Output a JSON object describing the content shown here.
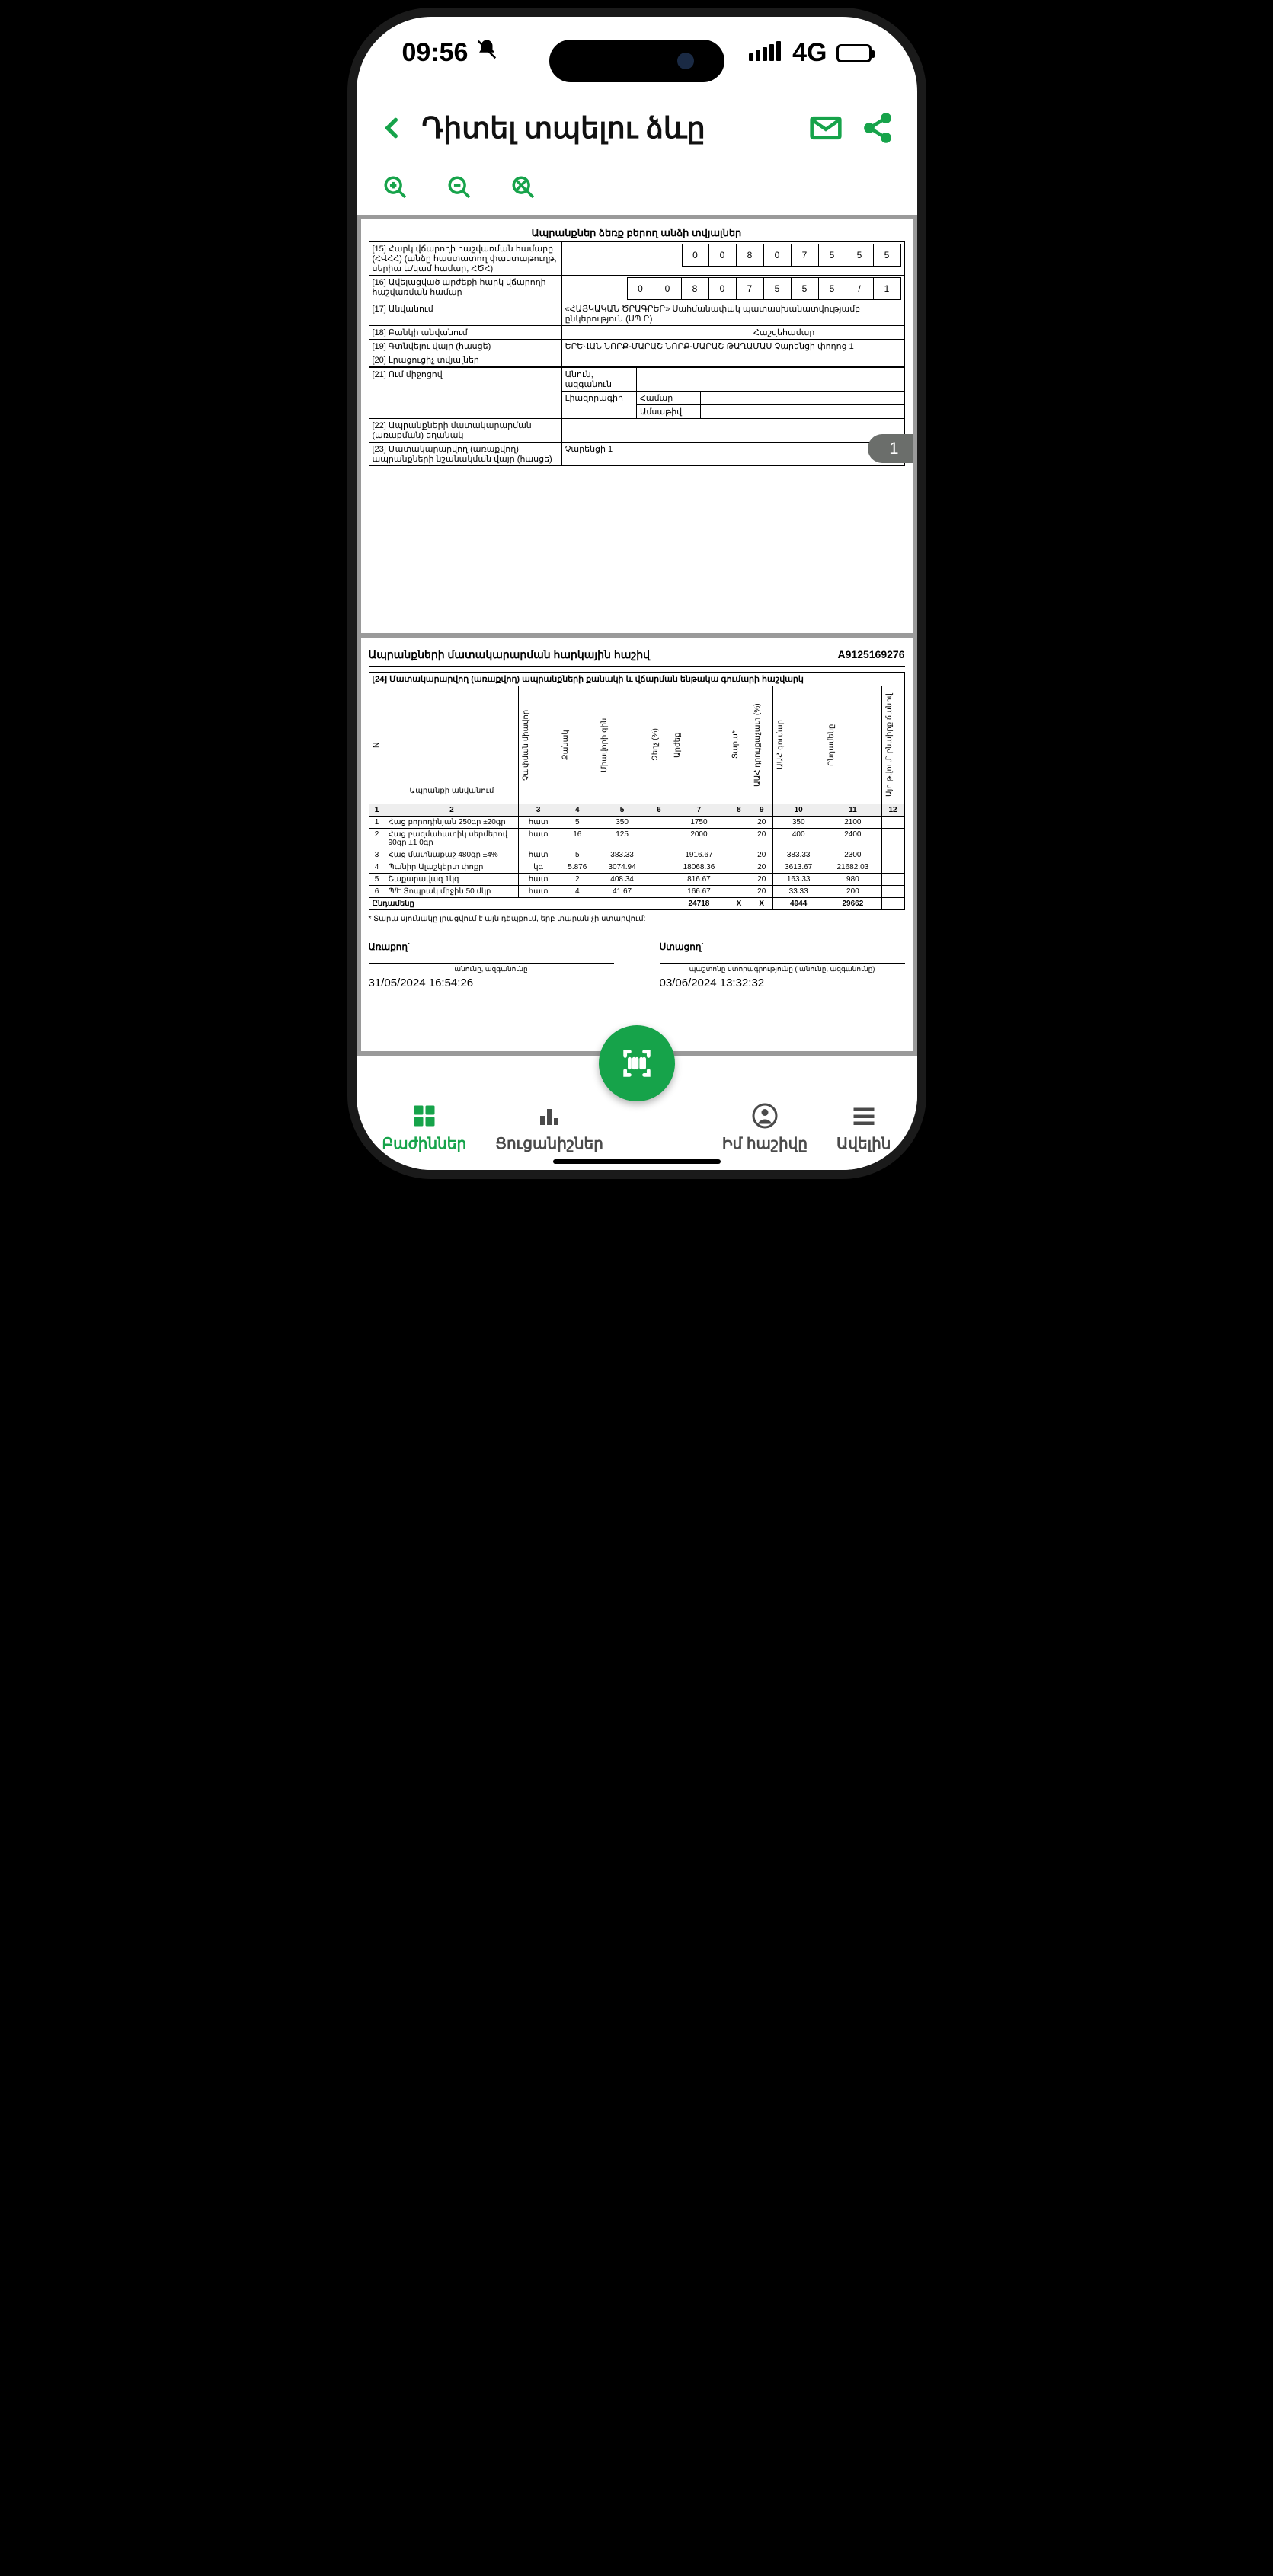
{
  "status": {
    "time": "09:56",
    "network": "4G"
  },
  "header": {
    "title": "Դիտել տպելու ձևը"
  },
  "page_tab": "1",
  "section1": {
    "title": "Ապրանքներ ձեռք բերող անձի տվյալներ",
    "row15_label": "[15] Հարկ վճարողի հաշվառման համարը (ՀՎՀՀ) (անձը հաստատող փաստաթուղթ, սերիա և/կամ համար, ՀԾՀ)",
    "row15_digits": [
      "0",
      "0",
      "8",
      "0",
      "7",
      "5",
      "5",
      "5"
    ],
    "row16_label": "[16] Ավելացված արժեքի հարկ վճարողի հաշվառման համար",
    "row16_digits": [
      "0",
      "0",
      "8",
      "0",
      "7",
      "5",
      "5",
      "5",
      "/",
      "1"
    ],
    "row17_label": "[17] Անվանում",
    "row17_value": "«ՀԱՅԿԱԿԱՆ ԾՐԱԳՐԵՐ» Սահմանափակ պատասխանատվությամբ ընկերություն (ՍՊ Ը)",
    "row18_label": "[18] Բանկի անվանում",
    "row18_col2_label": "Հաշվեհամար",
    "row19_label": "[19] Գտնվելու վայր (հասցե)",
    "row19_value": "ԵՐԵՎԱՆ ՆՈՐՔ-ՄԱՐԱՇ ՆՈՐՔ-ՄԱՐԱՇ ԹԱՂԱՄԱՍ Չարենցի փողոց 1",
    "row20_label": "[20] Լրացուցիչ տվյալներ",
    "row21_label": "[21] Ում միջոցով",
    "row21_a": "Անուն, ազգանուն",
    "row21_b": "Լիազորագիր",
    "row21_b1": "Համար",
    "row21_b2": "Ամսաթիվ",
    "row22_label": "[22] Ապրանքների մատակարարման (առաքման) եղանակ",
    "row23_label": "[23] Մատակարարվող (առաքվող) ապրանքների նշանակման վայր (հասցե)",
    "row23_value": "Չարենցի 1"
  },
  "section2": {
    "title_left": "Ապրանքների մատակարարման հարկային հաշիվ",
    "title_right": "A9125169276",
    "row24_header": "[24] Մատակարարվող (առաքվող) ապրանքների քանակի և վճարման ենթակա գումարի հաշվարկ",
    "cols": {
      "c1": "N",
      "c2": "Ապրանքի անվանում",
      "c3": "Չափման միավոր",
      "c4": "Քանակ",
      "c5": "Միավորի գին",
      "c6": "Զեղչ (%)",
      "c7": "Արժեք",
      "c8": "Տարա*",
      "c9": "ԱԱՀ դրույքաչափ (%)",
      "c10": "ԱԱՀ գումար",
      "c11": "Ընդամենը",
      "c12": "Այդ թվում` բնաիրք ճանով"
    },
    "colnums": [
      "1",
      "2",
      "3",
      "4",
      "5",
      "6",
      "7",
      "8",
      "9",
      "10",
      "11",
      "12"
    ],
    "rows": [
      {
        "n": "1",
        "name": "Հաց բորոդինյան 250գր ±20գր",
        "unit": "հատ",
        "qty": "5",
        "price": "350",
        "disc": "",
        "val": "1750",
        "tara": "",
        "vatp": "20",
        "vat": "350",
        "total": "2100",
        "natk": ""
      },
      {
        "n": "2",
        "name": "Հաց բազմահատիկ սերմերով 90գր ±1 0գր",
        "unit": "հատ",
        "qty": "16",
        "price": "125",
        "disc": "",
        "val": "2000",
        "tara": "",
        "vatp": "20",
        "vat": "400",
        "total": "2400",
        "natk": ""
      },
      {
        "n": "3",
        "name": "Հաց մատնաքաշ 480գր ±4%",
        "unit": "հատ",
        "qty": "5",
        "price": "383.33",
        "disc": "",
        "val": "1916.67",
        "tara": "",
        "vatp": "20",
        "vat": "383.33",
        "total": "2300",
        "natk": ""
      },
      {
        "n": "4",
        "name": "Պանիր Ալաշկերտ փոքր",
        "unit": "կգ",
        "qty": "5.876",
        "price": "3074.94",
        "disc": "",
        "val": "18068.36",
        "tara": "",
        "vatp": "20",
        "vat": "3613.67",
        "total": "21682.03",
        "natk": ""
      },
      {
        "n": "5",
        "name": "Շաքարավազ 1կգ",
        "unit": "հատ",
        "qty": "2",
        "price": "408.34",
        "disc": "",
        "val": "816.67",
        "tara": "",
        "vatp": "20",
        "vat": "163.33",
        "total": "980",
        "natk": ""
      },
      {
        "n": "6",
        "name": "Պ/Է Տոպրակ միջին 50 մկր",
        "unit": "հատ",
        "qty": "4",
        "price": "41.67",
        "disc": "",
        "val": "166.67",
        "tara": "",
        "vatp": "20",
        "vat": "33.33",
        "total": "200",
        "natk": ""
      }
    ],
    "total_label": "Ընդամենը",
    "totals": {
      "val": "24718",
      "tara": "X",
      "vatp": "X",
      "vat": "4944",
      "total": "29662"
    },
    "footnote": "* Տարա սյունակը լրացվում է այն դեպքում, երբ տարան չի ստարվում:",
    "sig_left_label": "Առաքող`",
    "sig_left_sub": "անունը, ազգանունը",
    "sig_left_date": "31/05/2024 16:54:26",
    "sig_right_label": "Ստացող`",
    "sig_right_sub": "պաշտոնը  ստորագրությունը  ( անունը, ազգանունը)",
    "sig_right_date": "03/06/2024 13:32:32"
  },
  "nav": {
    "sections": "Բաժիններ",
    "indicators": "Ցուցանիշներ",
    "account": "Իմ հաշիվը",
    "more": "Ավելին"
  }
}
